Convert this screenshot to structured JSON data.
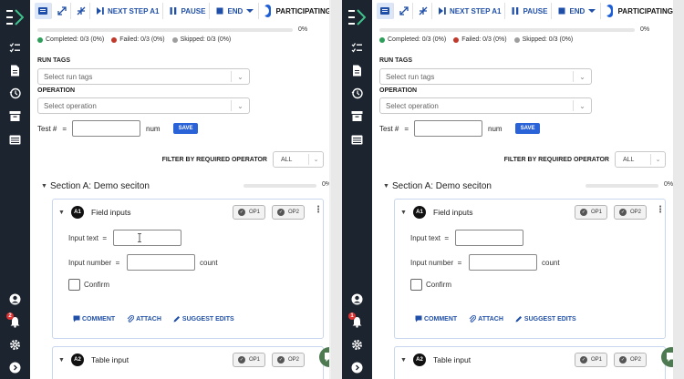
{
  "toolbar": {
    "next_step": "NEXT STEP A1",
    "pause": "PAUSE",
    "end": "END",
    "participating": "PARTICIPATING"
  },
  "progress": {
    "percent": "0%",
    "completed": "Completed: 0/3 (0%)",
    "failed": "Failed: 0/3 (0%)",
    "skipped": "Skipped: 0/3 (0%)"
  },
  "form": {
    "run_tags_label": "RUN TAGS",
    "run_tags_placeholder": "Select run tags",
    "operation_label": "OPERATION",
    "operation_placeholder": "Select operation",
    "test_label": "Test #",
    "equals": "=",
    "num_unit": "num",
    "save": "SAVE"
  },
  "filter": {
    "label": "FILTER BY REQUIRED OPERATOR",
    "value": "ALL"
  },
  "section": {
    "title": "Section A: Demo seciton",
    "percent": "0%"
  },
  "steps": [
    {
      "badge": "A1",
      "title": "Field inputs",
      "op1": "OP1",
      "op2": "OP2",
      "input_text_label": "Input text",
      "input_number_label": "Input number",
      "equals": "=",
      "count_unit": "count",
      "confirm_label": "Confirm",
      "comment": "COMMENT",
      "attach": "ATTACH",
      "suggest_edits": "SUGGEST EDITS"
    },
    {
      "badge": "A2",
      "title": "Table input",
      "op1": "OP1",
      "op2": "OP2"
    }
  ],
  "sidebar": {
    "notification_count_left": "2",
    "notification_count_right": "1"
  },
  "colors": {
    "sidebar_bg": "#1c2430",
    "accent_blue": "#1f4fa8",
    "save_blue": "#2a62d8",
    "completed": "#2e9e5b",
    "failed": "#c0392b",
    "skipped": "#9e9e9e",
    "chat_green": "#4e7a52"
  },
  "icons": [
    "logo-icon",
    "checklist-icon",
    "document-icon",
    "history-icon",
    "archive-icon",
    "list-icon",
    "user-icon",
    "bell-icon",
    "gear-icon",
    "chevron-right-icon",
    "chat-icon"
  ]
}
